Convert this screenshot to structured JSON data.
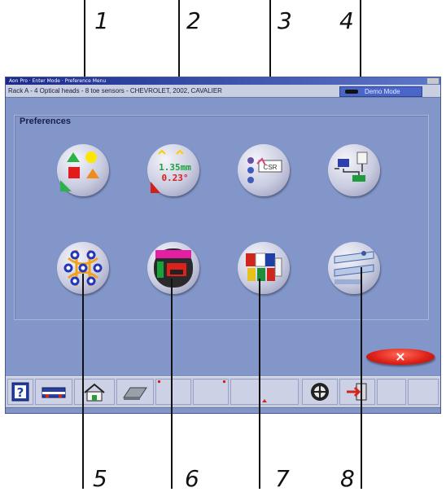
{
  "callouts": {
    "top": [
      "1",
      "2",
      "3",
      "4"
    ],
    "bottom": [
      "5",
      "6",
      "7",
      "8"
    ]
  },
  "window": {
    "title": "Aon Pro · Enter Mode · Preference Menu",
    "status_text": "Rack A - 4 Optical heads - 8 toe sensors - CHEVROLET, 2002, CAVALIER",
    "mode_label": "Demo Mode"
  },
  "panel": {
    "title": "Preferences"
  },
  "buttons": {
    "units": {
      "line1": "1.35mm",
      "line2": "0.23°"
    },
    "printer_tag": "CSR"
  },
  "close_label": "×",
  "toolbar": {
    "help_label": "?"
  },
  "colors": {
    "window_bg": "#8296c9",
    "titlebar": "#1b2a8c",
    "close_button": "#e0231a",
    "mode_badge": "#4a66c8"
  },
  "icons": [
    "color-shapes-icon",
    "units-icon",
    "printer-setup-icon",
    "network-icon",
    "sensor-layout-icon",
    "shop-info-icon",
    "language-flags-icon",
    "alignment-lift-icon",
    "help-icon",
    "keyboard-icon",
    "home-icon",
    "eraser-icon",
    "wheel-icon",
    "exit-icon"
  ]
}
